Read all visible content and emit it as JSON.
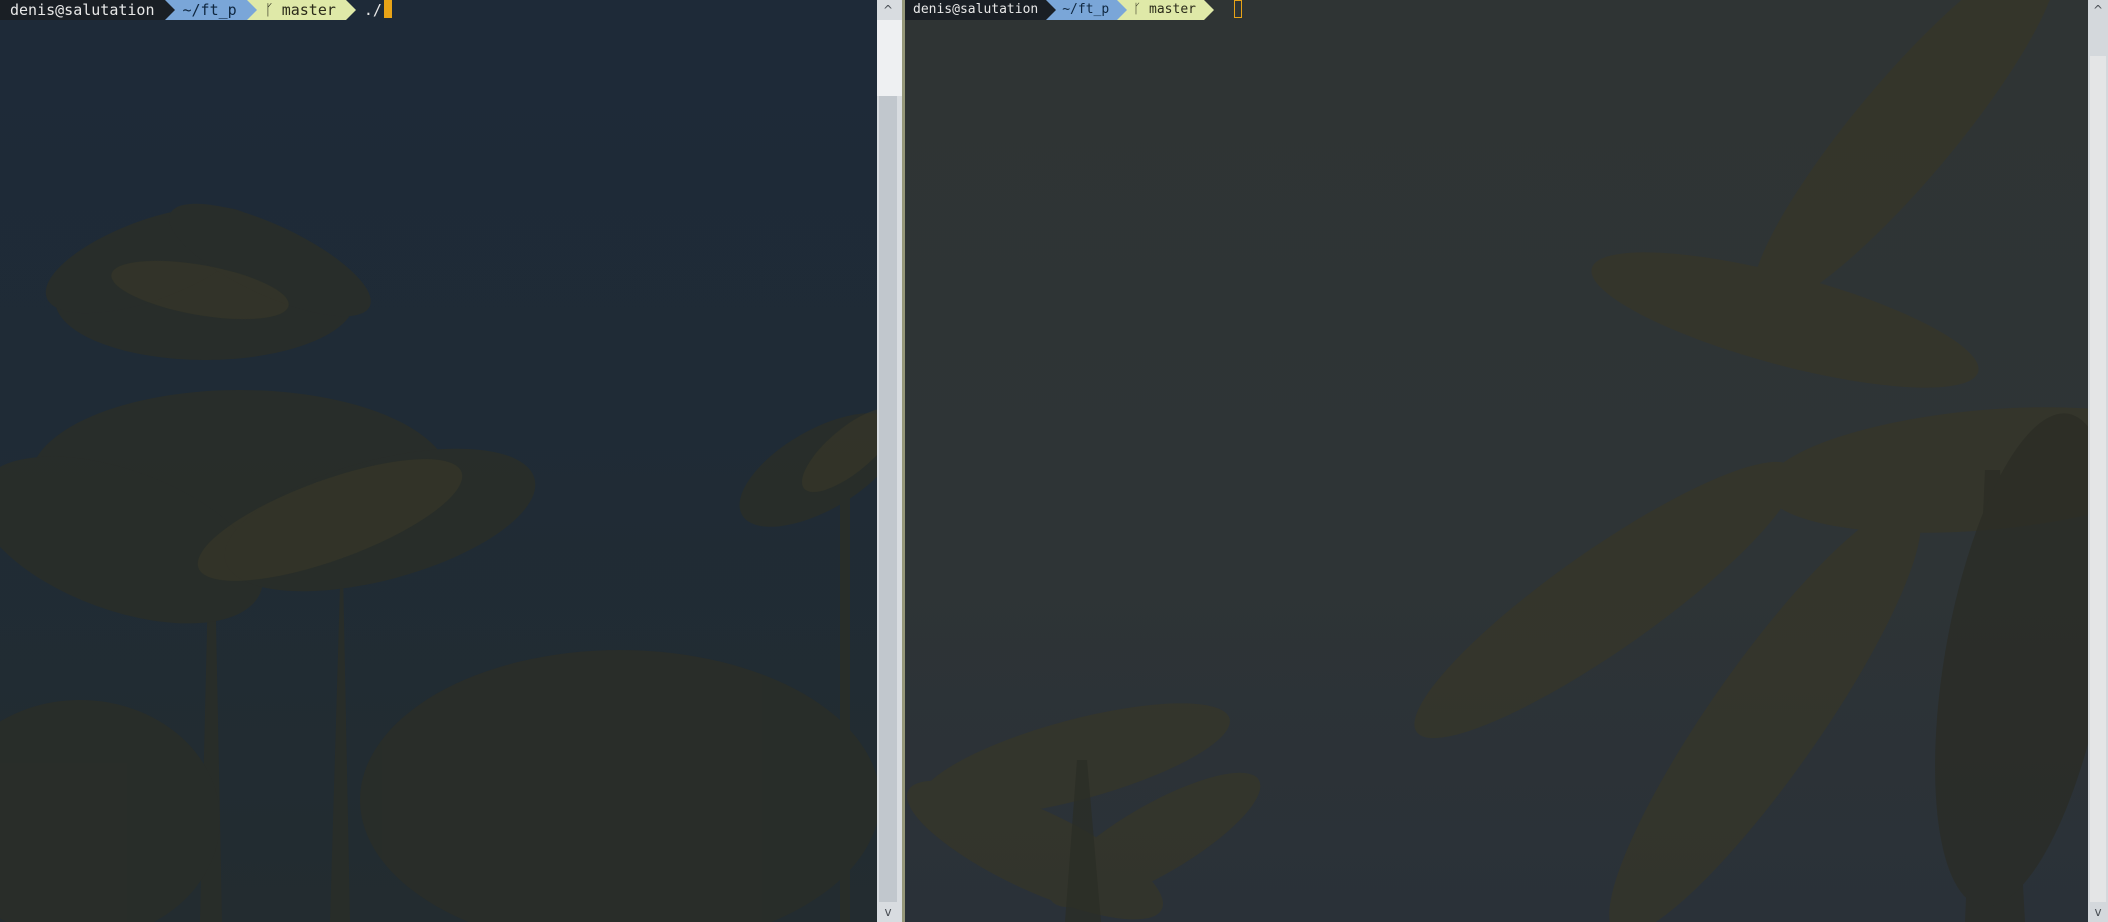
{
  "left_pane": {
    "prompt": {
      "user_host": "denis@salutation",
      "directory": "~/ft_p",
      "branch_glyph": "ᚴ",
      "branch": "master",
      "command": "./"
    }
  },
  "right_pane": {
    "prompt": {
      "user_host": "denis@salutation",
      "directory": "~/ft_p",
      "branch_glyph": "ᚴ",
      "branch": "master",
      "command": ""
    }
  },
  "scrollbars": {
    "up_arrow": "^",
    "down_arrow": "v"
  },
  "colors": {
    "user_segment": "#1a1f25",
    "directory_segment": "#7aa6d8",
    "git_segment": "#dfe9a8",
    "cursor": "#e8a317",
    "active_pane_border": "#3c86d6"
  },
  "icons": {
    "branch": "git-branch-icon",
    "scroll_up": "chevron-up-icon",
    "scroll_down": "chevron-down-icon"
  }
}
